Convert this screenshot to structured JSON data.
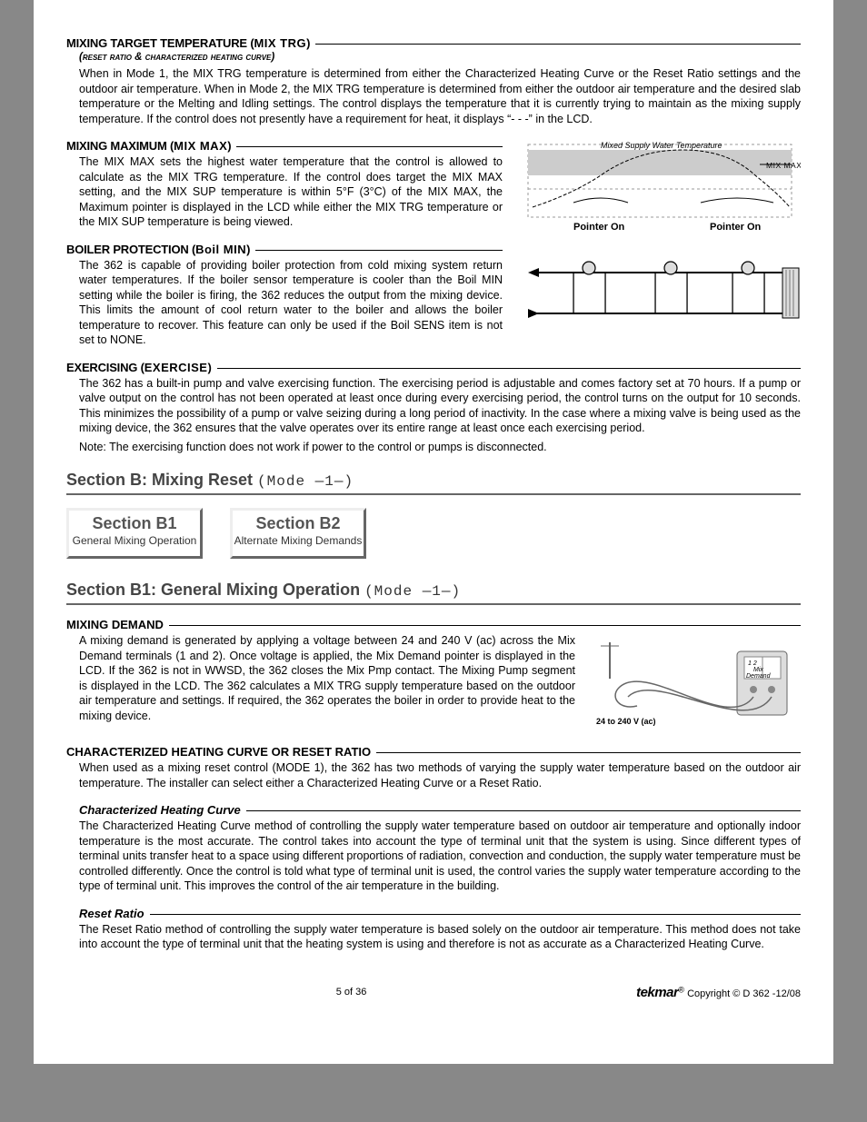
{
  "h1": {
    "title": "MIXING TARGET TEMPERATURE (",
    "tail": "MIX TRG",
    "close": ")"
  },
  "h1_sub": "(reset ratio & characterized heating curve)",
  "p1": "When in Mode 1, the MIX TRG temperature is determined from either the Characterized Heating Curve or the Reset Ratio settings and the outdoor air temperature. When in Mode 2, the MIX TRG temperature is determined from either the outdoor air temperature and the desired slab temperature or the Melting and Idling settings. The control displays the temperature that it is currently trying to maintain as the mixing supply temperature. If the control does not presently have a requirement for heat, it displays “- - -” in the LCD.",
  "h2": {
    "title": "MIXING MAXIMUM (",
    "tail": "MIX MAX",
    "close": ")"
  },
  "p2": "The MIX MAX sets the highest water temperature that the control is allowed to calculate as the MIX TRG temperature. If the control does target the MIX MAX setting, and the MIX SUP temperature is within 5°F (3°C) of the  MIX MAX, the Maximum pointer is displayed in the LCD while either the MIX TRG temperature or the MIX SUP temperature is being viewed.",
  "h3": {
    "title": "BOILER PROTECTION (",
    "tail": "Boil MIN",
    "close": " )"
  },
  "p3": "The 362 is capable of providing boiler protection from cold mixing system return water temperatures. If the boiler sensor temperature is cooler than the Boil MIN setting while the boiler is firing, the 362 reduces the output from the mixing device. This limits the amount of cool return water to the boiler and allows the boiler temperature to recover. This feature can only be used if the Boil SENS item is not set to NONE.",
  "h4": {
    "title": "EXERCISING (",
    "tail": "EXERCISE",
    "close": ")"
  },
  "p4": "The 362 has a built-in pump and valve exercising function. The exercising period is adjustable and comes factory set at 70 hours. If a pump or valve output on the control has not been operated at least once during every exercising period, the control turns on the output for 10 seconds. This minimizes the possibility of a pump or valve seizing during a long period of inactivity. In the case where a mixing valve is being used as the mixing device, the 362 ensures that the valve operates over its entire range at least once each exercising period.",
  "p4b": "Note: The exercising function does not work if power to the control or pumps is disconnected.",
  "secB": {
    "title": "Section B:  Mixing Reset",
    "mode": " (Mode —1—)"
  },
  "btn1": {
    "t1": "Section B1",
    "t2": "General Mixing Operation"
  },
  "btn2": {
    "t1": "Section B2",
    "t2": "Alternate Mixing Demands"
  },
  "secB1": {
    "title": "Section B1:  General Mixing Operation",
    "mode": " (Mode —1—)"
  },
  "h5": "MIXING DEMAND",
  "p5": "A mixing demand is generated by applying a voltage between 24 and 240 V (ac) across the Mix Demand terminals (1 and 2). Once voltage is applied, the Mix Demand pointer is displayed in the LCD. If the 362 is not in WWSD, the 362 closes the Mix Pmp contact. The Mixing Pump segment is displayed in the LCD. The 362 calculates a MIX TRG supply temperature based on the outdoor air temperature and settings. If required, the 362 operates the boiler in order to provide heat to the mixing device.",
  "h6": "CHARACTERIZED HEATING CURVE OR RESET RATIO",
  "p6": "When used as a mixing reset control (MODE 1), the 362 has two methods of varying the supply water temperature based on the outdoor air temperature. The  installer can select either a Characterized Heating Curve or a Reset Ratio.",
  "sh1": "Characterized Heating Curve",
  "p7": "The Characterized Heating Curve method of controlling the supply water temperature based on outdoor air temperature and optionally indoor temperature is the most accurate. The control takes into account the type of terminal unit that the system is using. Since different types of terminal units transfer heat to a space using different proportions of radiation, convection and conduction, the supply water temperature must be controlled differently. Once the control is told what type of terminal unit is used, the control varies the supply water temperature according to the type of terminal unit. This improves the control of the air temperature in the building.",
  "sh2": "Reset Ratio",
  "p8": "The Reset Ratio method of controlling the supply water temperature is based solely on the outdoor air temperature. This method does not take into account the type of terminal unit that the heating system is using and therefore is not as accurate as a Characterized Heating Curve.",
  "fig1": {
    "curve_label": "Mixed Supply Water Temperature",
    "mix_max": "MIX MAX",
    "pointer_on": "Pointer On"
  },
  "fig3": {
    "volts": "24 to 240 V (ac)",
    "t12": "1   2",
    "mix": "Mix",
    "demand": "Demand"
  },
  "footer": {
    "pg": "5 of 36",
    "brand": "tekmar",
    "copy": " Copyright © D 362 -12/08"
  }
}
